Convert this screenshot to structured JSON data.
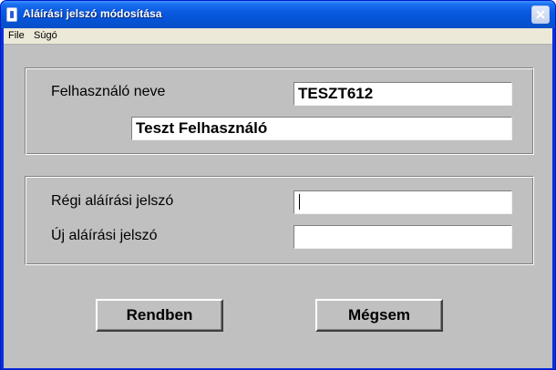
{
  "window": {
    "title": "Aláírási jelszó módosítása"
  },
  "menu": {
    "items": [
      "File",
      "Súgó"
    ]
  },
  "user_group": {
    "username_label": "Felhasználó neve",
    "username_value": "TESZT612",
    "fullname_value": "Teszt Felhasználó"
  },
  "password_group": {
    "old_label": "Régi aláírási jelszó",
    "old_value": "",
    "new_label": "Új aláírási jelszó",
    "new_value": ""
  },
  "buttons": {
    "ok_label": "Rendben",
    "cancel_label": "Mégsem"
  },
  "colors": {
    "titlebar": "#0a5ae0",
    "client_background": "#c0c0c0",
    "menubar": "#ece9d8"
  },
  "icons": {
    "app": "app-icon",
    "close": "close-icon"
  }
}
